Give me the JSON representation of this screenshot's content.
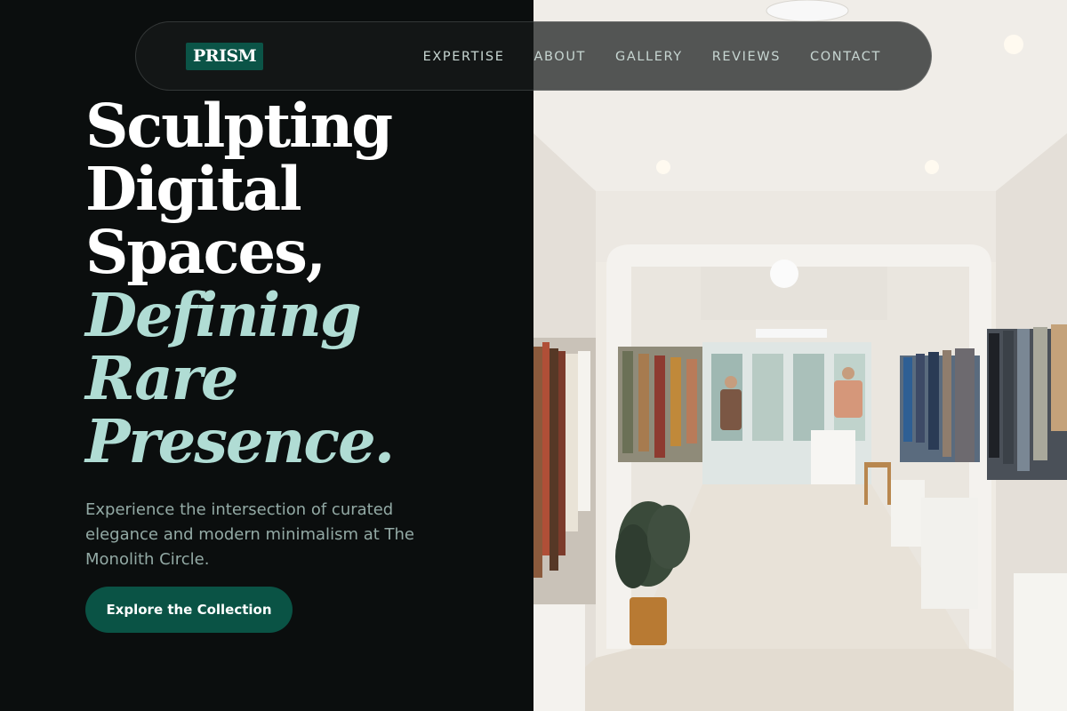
{
  "brand": {
    "logo_text": "PRISM",
    "accent_color": "#0b5447",
    "highlight_color": "#b0dcd4"
  },
  "nav": {
    "links": [
      "EXPERTISE",
      "ABOUT",
      "GALLERY",
      "REVIEWS",
      "CONTACT"
    ]
  },
  "hero": {
    "headline_lines": [
      "Sculpting",
      "Digital",
      "Spaces,"
    ],
    "accent_lines": [
      "Defining",
      "Rare",
      "Presence."
    ],
    "description": "Experience the intersection of curated elegance and modern minimalism at The Monolith Circle.",
    "cta_label": "Explore the Collection"
  },
  "hero_image": {
    "subject": "bright white clothing boutique interior with clothing racks"
  }
}
